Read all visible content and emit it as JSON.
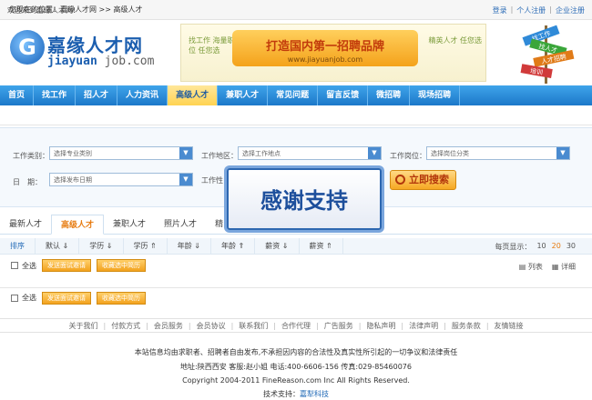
{
  "topbar": {
    "welcome": "欢迎来到嘉缘人才网!",
    "links": [
      "登录",
      "个人注册",
      "企业注册"
    ],
    "sep": "|"
  },
  "logo": {
    "name": "嘉缘人才网",
    "domain_a": "jiayuan",
    "domain_b": "job.com"
  },
  "banner": {
    "left_text": "找工作 海量职位 任您选",
    "main": "打造国内第一招聘品牌",
    "url": "www.jiayuanjob.com",
    "right_text": "精英人才 任您选"
  },
  "signpost": {
    "labels": [
      "找工作",
      "找人才",
      "人才招聘",
      "培训"
    ]
  },
  "nav": {
    "items": [
      "首页",
      "找工作",
      "招人才",
      "人力资讯",
      "高级人才",
      "兼职人才",
      "常见问题",
      "留言反馈",
      "微招聘",
      "现场招聘"
    ],
    "active_index": 4
  },
  "breadcrumb": {
    "text": "您现在的位置：嘉缘人才网 >> 高级人才"
  },
  "search": {
    "job_category_label": "工作类别：",
    "job_category_value": "选择专业类别",
    "job_area_label": "工作地区：",
    "job_area_value": "选择工作地点",
    "job_position_label": "工作岗位：",
    "job_position_value": "选择岗位分类",
    "date_label": "日　期：",
    "date_value": "选择发布日期",
    "work_nature_label": "工作性",
    "button": "立即搜索"
  },
  "overlay": {
    "text": "感谢支持"
  },
  "tabs": {
    "items": [
      "最新人才",
      "高级人才",
      "兼职人才",
      "照片人才",
      "精"
    ],
    "active_index": 1
  },
  "sort": {
    "items": [
      "排序",
      "默认 ⇓",
      "学历 ⇓",
      "学历 ⇑",
      "年龄 ⇓",
      "年龄 ⇑",
      "薪资 ⇓",
      "薪资 ⇑"
    ]
  },
  "pagesize": {
    "label": "每页显示：",
    "options": [
      "10",
      "20",
      "30"
    ],
    "active": "20"
  },
  "actions": {
    "select_all": "全选",
    "send_invite": "发送面试邀请",
    "save_resume": "收藏选中简历"
  },
  "view": {
    "list": "列表",
    "detail": "详细"
  },
  "footer": {
    "links": [
      "关于我们",
      "付款方式",
      "会员服务",
      "会员协议",
      "联系我们",
      "合作代理",
      "广告服务",
      "隐私声明",
      "法律声明",
      "服务条款",
      "友情链接"
    ],
    "sep": "|",
    "disclaimer": "本站信息均由求职者、招聘者自由发布,不承担因内容的合法性及真实性所引起的一切争议和法律责任",
    "address": "地址:陕西西安 客服:赵小姐 电话:400-6606-156 传真:029-85460076",
    "copyright": "Copyright 2004-2011 FineReason.com Inc All Rights Reserved.",
    "support_label": "技术支持：",
    "support_name": "嘉犁科技"
  }
}
